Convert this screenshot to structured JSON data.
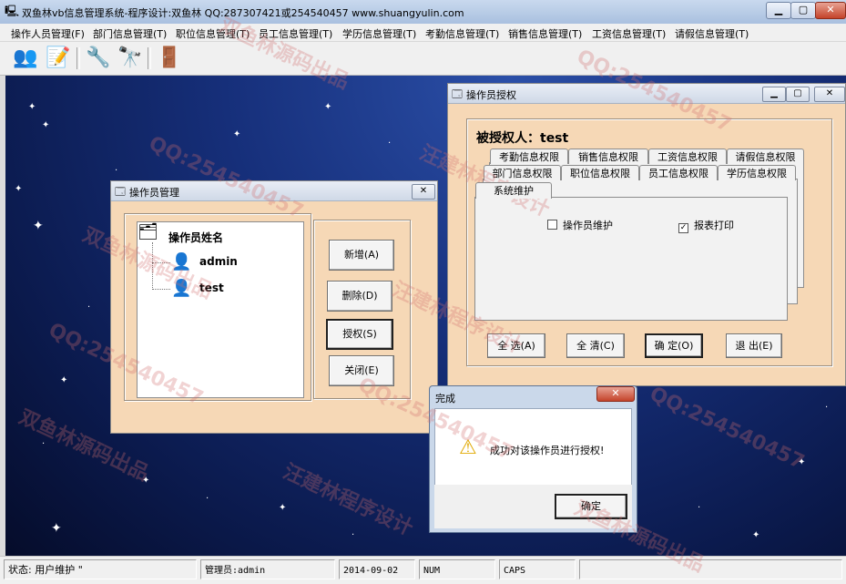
{
  "app": {
    "title": "双鱼林vb信息管理系统-程序设计:双鱼林 QQ:287307421或254540457 www.shuangyulin.com"
  },
  "menu": [
    "操作人员管理(F)",
    "部门信息管理(T)",
    "职位信息管理(T)",
    "员工信息管理(T)",
    "学历信息管理(T)",
    "考勤信息管理(T)",
    "销售信息管理(T)",
    "工资信息管理(T)",
    "请假信息管理(T)"
  ],
  "toolbar_icons": [
    "users-icon",
    "edit-document-icon",
    "tools-icon",
    "binoculars-icon",
    "exit-door-icon"
  ],
  "operator_window": {
    "title": "操作员管理",
    "tree_root": "操作员姓名",
    "users": [
      "admin",
      "test"
    ],
    "buttons": {
      "add": "新增(A)",
      "delete": "删除(D)",
      "grant": "授权(S)",
      "close": "关闭(E)"
    }
  },
  "grant_window": {
    "title": "操作员授权",
    "grantee_label": "被授权人：test",
    "tabs_row1": [
      "考勤信息权限",
      "销售信息权限",
      "工资信息权限",
      "请假信息权限"
    ],
    "tabs_row2": [
      "部门信息权限",
      "职位信息权限",
      "员工信息权限",
      "学历信息权限"
    ],
    "tabs_row3": [
      "系统维护"
    ],
    "checkboxes": [
      {
        "label": "操作员维护",
        "checked": false
      },
      {
        "label": "报表打印",
        "checked": true
      }
    ],
    "buttons": {
      "select_all": "全 选(A)",
      "clear_all": "全 清(C)",
      "ok": "确 定(O)",
      "exit": "退 出(E)"
    }
  },
  "dialog": {
    "title": "完成",
    "message": "成功对该操作员进行授权!",
    "ok": "确定"
  },
  "statusbar": {
    "status": "状态:  用户维护 \"",
    "admin": "管理员:admin",
    "date": "2014-09-02",
    "num": "NUM",
    "caps": "CAPS"
  },
  "watermarks": [
    "双鱼林源码出品",
    "QQ:254540457",
    "汪建林程序设计"
  ],
  "colors": {
    "window_bg": "#f6d8b6",
    "desktop": "#162f7a"
  }
}
